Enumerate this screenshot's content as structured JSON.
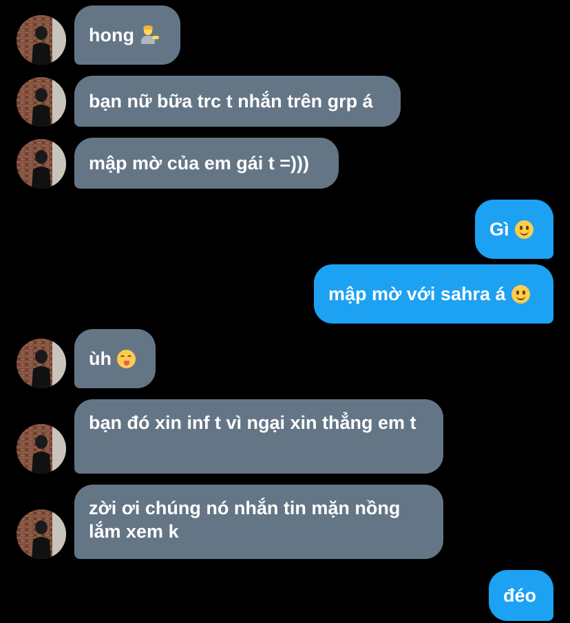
{
  "conversation": {
    "messages": [
      {
        "side": "in",
        "text": "hong",
        "emoji": "person-tipping-hand-emoji"
      },
      {
        "side": "in",
        "text": "bạn nữ bữa trc t nhắn trên grp á"
      },
      {
        "side": "in",
        "text": "mập mờ của em gái t =)))"
      },
      {
        "side": "out",
        "text": "Gì",
        "emoji": "slightly-smiling-face-emoji"
      },
      {
        "side": "out",
        "text": "mập mờ với sahra á",
        "emoji": "slightly-smiling-face-emoji"
      },
      {
        "side": "in",
        "text": "ùh",
        "emoji": "face-savoring-food-emoji"
      },
      {
        "side": "in",
        "text": "bạn đó xin inf t vì ngại xin thẳng em t"
      },
      {
        "side": "in",
        "text": "zời ơi chúng nó nhắn tin mặn nồng lắm xem k"
      },
      {
        "side": "out",
        "text": "đéo"
      }
    ]
  },
  "colors": {
    "background": "#000000",
    "incoming_bubble": "#647686",
    "outgoing_bubble": "#1da1f2",
    "text": "#ffffff"
  }
}
